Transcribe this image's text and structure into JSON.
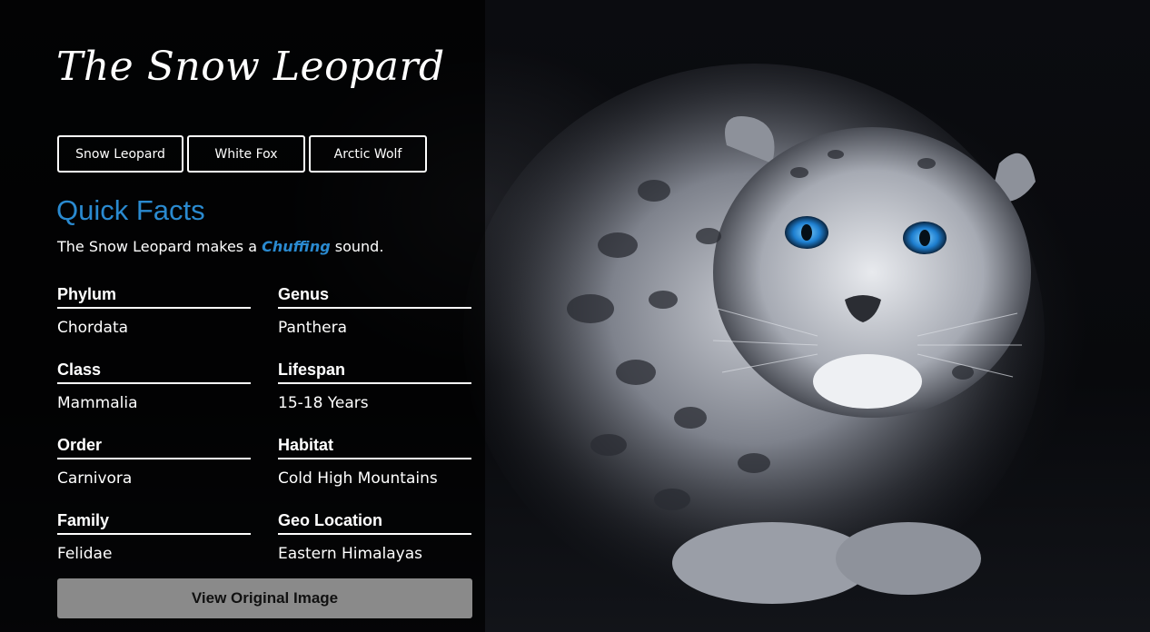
{
  "page": {
    "title": "The Snow Leopard"
  },
  "tabs": [
    {
      "label": "Snow Leopard"
    },
    {
      "label": "White Fox"
    },
    {
      "label": "Arctic Wolf"
    }
  ],
  "quick_facts": {
    "heading": "Quick Facts",
    "sound_prefix": "The Snow Leopard makes a ",
    "sound_word": "Chuffing",
    "sound_suffix": " sound.",
    "items": [
      {
        "label": "Phylum",
        "value": "Chordata"
      },
      {
        "label": "Genus",
        "value": "Panthera"
      },
      {
        "label": "Class",
        "value": "Mammalia"
      },
      {
        "label": "Lifespan",
        "value": "15-18 Years"
      },
      {
        "label": "Order",
        "value": "Carnivora"
      },
      {
        "label": "Habitat",
        "value": "Cold High Mountains"
      },
      {
        "label": "Family",
        "value": "Felidae"
      },
      {
        "label": "Geo Location",
        "value": "Eastern Himalayas"
      }
    ]
  },
  "actions": {
    "view_original": "View Original Image"
  },
  "colors": {
    "accent": "#2a8ad0",
    "button_bg": "#8a8a8a"
  }
}
